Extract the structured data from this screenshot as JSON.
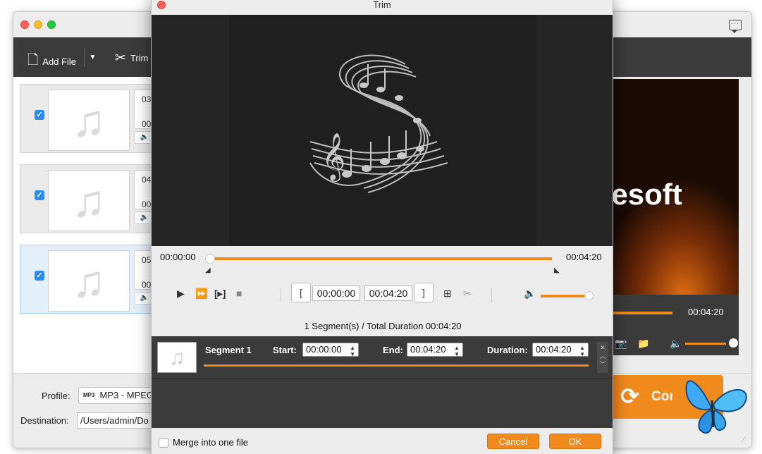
{
  "main_window": {
    "toolbar": {
      "add_file_label": "Add File",
      "trim_label": "Trim"
    },
    "files": [
      {
        "line1": "03",
        "line2": "00",
        "checked": true
      },
      {
        "line1": "04",
        "line2": "00",
        "checked": true
      },
      {
        "line1": "05",
        "line2": "00",
        "checked": true
      }
    ],
    "profile_label": "Profile:",
    "profile_value": "MP3 - MPEG",
    "profile_format_badge": "MP3",
    "destination_label": "Destination:",
    "destination_value": "/Users/admin/Do",
    "preview": {
      "logo_text": "eesoft",
      "time": "00:04:20"
    },
    "convert_label": "Convert",
    "colors": {
      "accent": "#f08a1c",
      "toolbar": "#3b3b3b",
      "check": "#2a8bf2"
    }
  },
  "trim_dialog": {
    "title": "Trim",
    "timeline": {
      "start": "00:00:00",
      "end": "00:04:20",
      "progress": 1.0
    },
    "controls": {
      "start_field": "00:00:00",
      "end_field": "00:04:20",
      "volume_level": 0.9,
      "set_start_label": "[",
      "set_end_label": "]"
    },
    "summary": "1 Segment(s) / Total Duration 00:04:20",
    "segments": [
      {
        "name": "Segment 1",
        "start_label": "Start:",
        "start": "00:00:00",
        "end_label": "End:",
        "end": "00:04:20",
        "duration_label": "Duration:",
        "duration": "00:04:20"
      }
    ],
    "merge_label": "Merge into one file",
    "merge_checked": false,
    "cancel_label": "Cancel",
    "ok_label": "OK"
  }
}
